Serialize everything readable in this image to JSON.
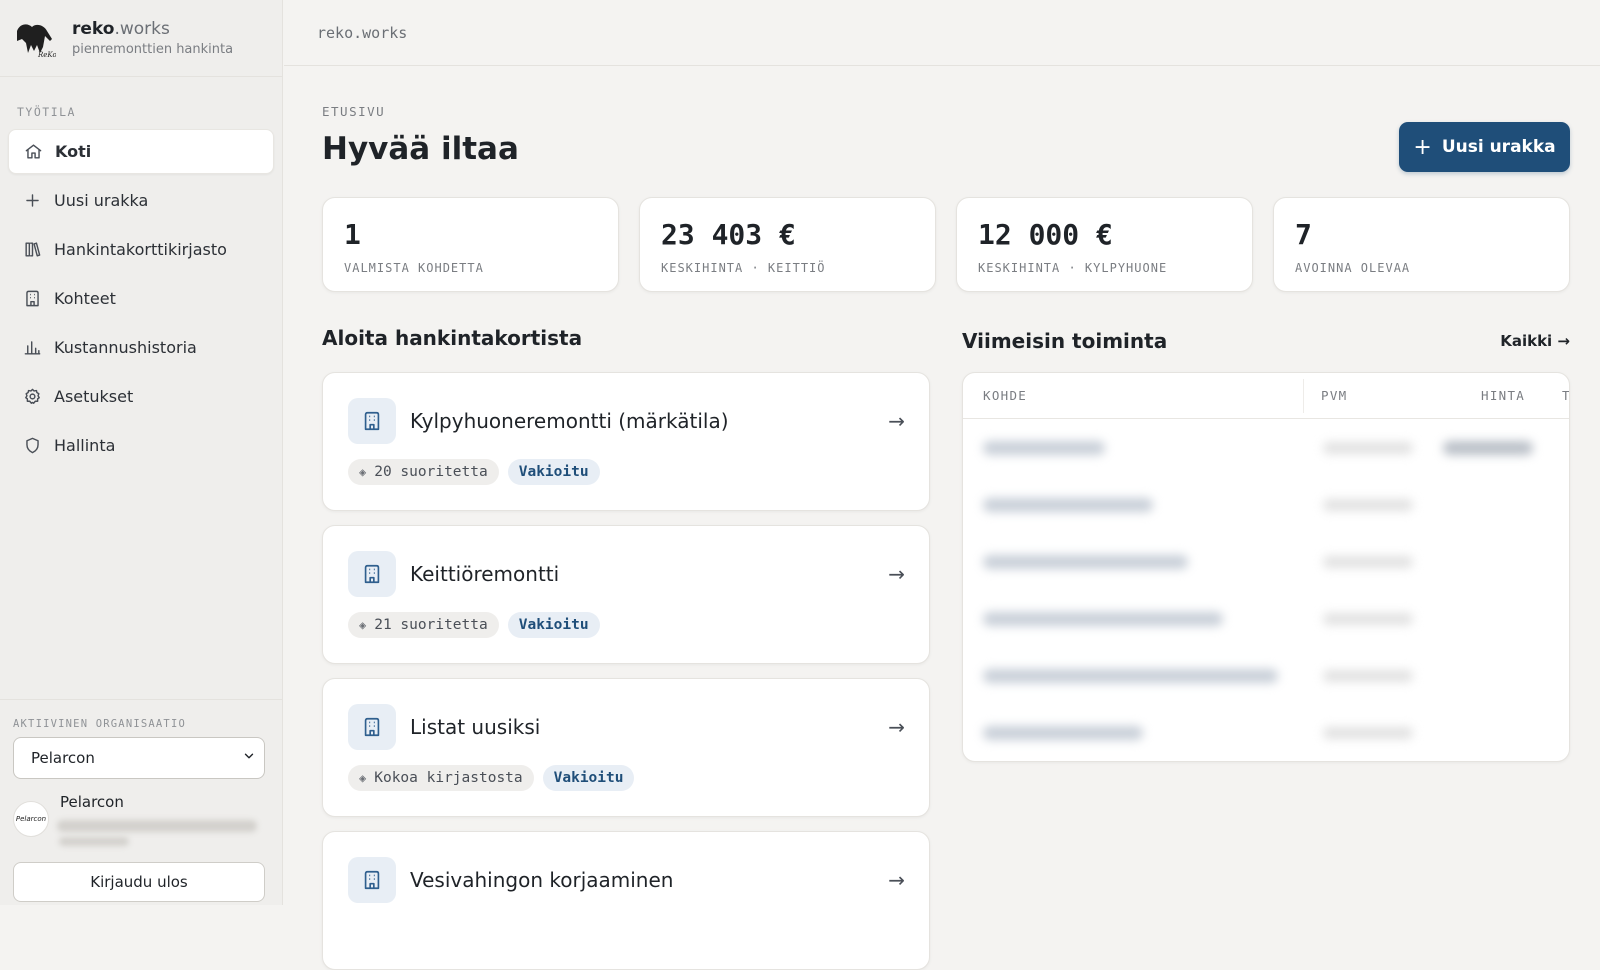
{
  "brand": {
    "name": "reko",
    "name_suffix": ".works",
    "subtitle": "pienremonttien hankinta"
  },
  "sidebar": {
    "section_label": "TYÖTILA",
    "items": [
      {
        "label": "Koti",
        "icon": "home-icon",
        "active": true
      },
      {
        "label": "Uusi urakka",
        "icon": "plus-icon"
      },
      {
        "label": "Hankintakorttikirjasto",
        "icon": "library-icon"
      },
      {
        "label": "Kohteet",
        "icon": "building-icon"
      },
      {
        "label": "Kustannushistoria",
        "icon": "bar-chart-icon"
      },
      {
        "label": "Asetukset",
        "icon": "gear-icon"
      },
      {
        "label": "Hallinta",
        "icon": "shield-icon"
      }
    ],
    "org_label": "AKTIIVINEN ORGANISAATIO",
    "org_selected": "Pelarcon",
    "user_name": "Pelarcon",
    "avatar_text": "Pelarcon",
    "logout_label": "Kirjaudu ulos"
  },
  "topbar": {
    "title": "reko.works"
  },
  "main": {
    "breadcrumb": "ETUSIVU",
    "title": "Hyvää iltaa",
    "new_button": "Uusi urakka",
    "stats": [
      {
        "value": "1",
        "label": "VALMISTA KOHDETTA"
      },
      {
        "value": "23 403 €",
        "label": "KESKIHINTA · KEITTIÖ"
      },
      {
        "value": "12 000 €",
        "label": "KESKIHINTA · KYLPYHUONE"
      },
      {
        "value": "7",
        "label": "AVOINNA OLEVAA"
      }
    ],
    "cards_heading": "Aloita hankintakortista",
    "cards": [
      {
        "title": "Kylpyhuoneremontti (märkätila)",
        "chip": "20 suoritetta",
        "tag": "Vakioitu"
      },
      {
        "title": "Keittiöremontti",
        "chip": "21 suoritetta",
        "tag": "Vakioitu"
      },
      {
        "title": "Listat uusiksi",
        "chip": "Kokoa kirjastosta",
        "tag": "Vakioitu"
      },
      {
        "title": "Vesivahingon korjaaminen"
      }
    ],
    "activity_heading": "Viimeisin toiminta",
    "activity_all": "Kaikki →",
    "activity_columns": {
      "kohde": "KOHDE",
      "pvm": "PVM",
      "hinta": "HINTA",
      "extra": "T"
    }
  },
  "colors": {
    "accent": "#1f4e79",
    "tag_bg": "#e8eef5",
    "sidebar_bg": "#efeeec",
    "page_bg": "#f4f3f1"
  }
}
